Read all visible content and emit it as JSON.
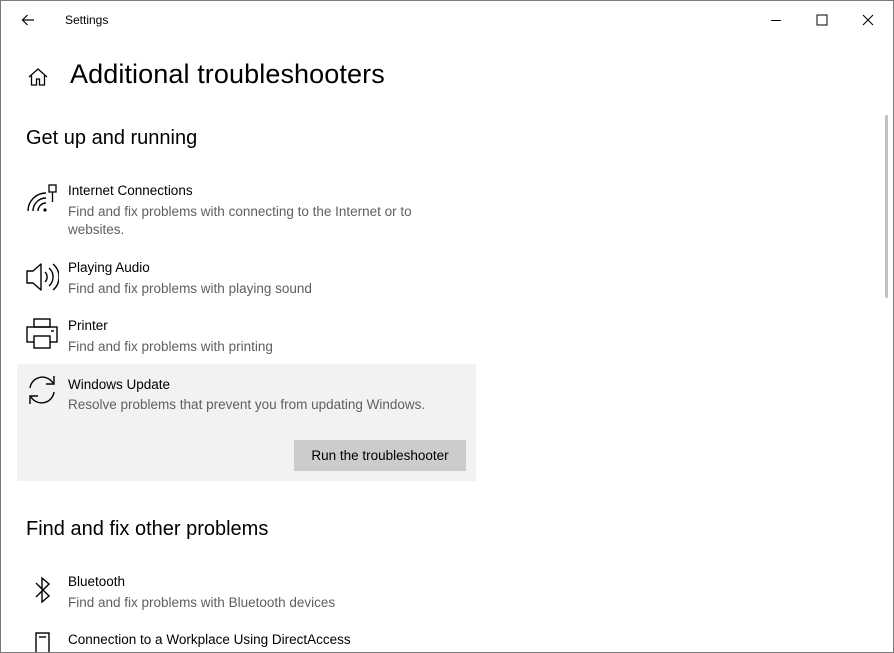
{
  "window": {
    "title": "Settings",
    "back_icon": "back-arrow-icon",
    "controls": [
      "minimize-icon",
      "maximize-icon",
      "close-icon"
    ]
  },
  "header": {
    "home_icon": "home-icon",
    "title": "Additional troubleshooters"
  },
  "sections": [
    {
      "title": "Get up and running",
      "items": [
        {
          "icon": "internet-connections-icon",
          "name": "Internet Connections",
          "description": "Find and fix problems with connecting to the Internet or to websites."
        },
        {
          "icon": "speaker-icon",
          "name": "Playing Audio",
          "description": "Find and fix problems with playing sound"
        },
        {
          "icon": "printer-icon",
          "name": "Printer",
          "description": "Find and fix problems with printing"
        },
        {
          "icon": "sync-icon",
          "name": "Windows Update",
          "description": "Resolve problems that prevent you from updating Windows.",
          "selected": true,
          "action_label": "Run the troubleshooter"
        }
      ]
    },
    {
      "title": "Find and fix other problems",
      "items": [
        {
          "icon": "bluetooth-icon",
          "name": "Bluetooth",
          "description": "Find and fix problems with Bluetooth devices"
        },
        {
          "icon": "workplace-device-icon",
          "name": "Connection to a Workplace Using DirectAccess",
          "description": ""
        }
      ]
    }
  ],
  "colors": {
    "selected_bg": "#f2f2f2",
    "button_bg": "#cccccc",
    "secondary_text": "#5f5f5f"
  }
}
